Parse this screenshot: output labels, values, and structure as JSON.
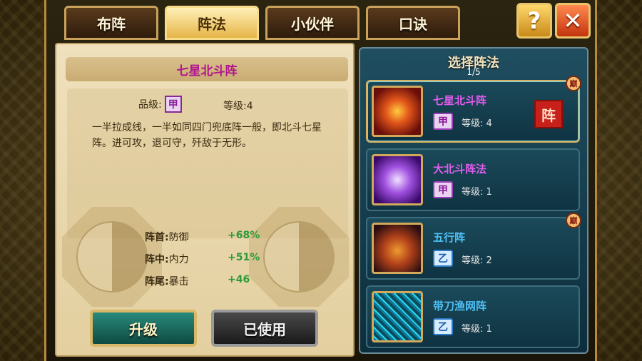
{
  "tabs": [
    {
      "label": "布阵",
      "active": false
    },
    {
      "label": "阵法",
      "active": true
    },
    {
      "label": "小伙伴",
      "active": false
    },
    {
      "label": "口诀",
      "active": false
    }
  ],
  "top_buttons": {
    "help": "?",
    "close": "✕"
  },
  "detail": {
    "title": "七星北斗阵",
    "grade_label": "品级:",
    "grade": "甲",
    "level_label": "等级:",
    "level": "4",
    "description": "一半拉成线，一半如同四门兜底阵一般，即北斗七星阵。进可攻，退可守，歼敌于无形。",
    "stats": [
      {
        "position": "阵首:",
        "attribute": "防御",
        "value": "+68%"
      },
      {
        "position": "阵中:",
        "attribute": "内力",
        "value": "+51%"
      },
      {
        "position": "阵尾:",
        "attribute": "暴击",
        "value": "+46"
      }
    ],
    "upgrade_button": "升级",
    "used_button": "已使用"
  },
  "selector": {
    "title": "选择阵法",
    "page": "1/5",
    "items": [
      {
        "name": "七星北斗阵",
        "grade": "甲",
        "level_label": "等级:",
        "level": "4",
        "peak_badge": "巅",
        "seal": "阵",
        "name_color": "#e25cf0",
        "grade_color": "#9b3db8"
      },
      {
        "name": "大北斗阵法",
        "grade": "甲",
        "level_label": "等级:",
        "level": "1",
        "peak_badge": "",
        "seal": "",
        "name_color": "#e25cf0",
        "grade_color": "#9b3db8"
      },
      {
        "name": "五行阵",
        "grade": "乙",
        "level_label": "等级:",
        "level": "2",
        "peak_badge": "巅",
        "seal": "",
        "name_color": "#4fc0f5",
        "grade_color": "#2a78c8"
      },
      {
        "name": "带刀渔网阵",
        "grade": "乙",
        "level_label": "等级:",
        "level": "1",
        "peak_badge": "",
        "seal": "",
        "name_color": "#4fc0f5",
        "grade_color": "#2a78c8"
      }
    ]
  }
}
